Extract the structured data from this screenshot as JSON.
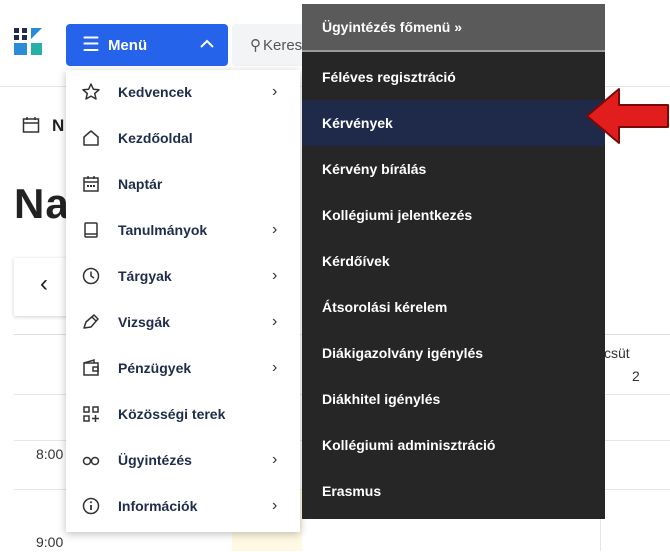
{
  "header": {
    "menu_label": "Menü",
    "search_text": "Keres"
  },
  "background": {
    "partial_label": "N",
    "big_title": "Na",
    "time_8": "8:00",
    "time_9": "9:00",
    "thursday_label": "csüt",
    "thursday_number": "2"
  },
  "main_menu": {
    "items": [
      {
        "label": "Kedvencek",
        "icon": "star-icon",
        "has_submenu": true
      },
      {
        "label": "Kezdőoldal",
        "icon": "home-icon",
        "has_submenu": false
      },
      {
        "label": "Naptár",
        "icon": "calendar-icon",
        "has_submenu": false
      },
      {
        "label": "Tanulmányok",
        "icon": "book-icon",
        "has_submenu": true
      },
      {
        "label": "Tárgyak",
        "icon": "clock-icon",
        "has_submenu": true
      },
      {
        "label": "Vizsgák",
        "icon": "edit-icon",
        "has_submenu": true
      },
      {
        "label": "Pénzügyek",
        "icon": "wallet-icon",
        "has_submenu": true
      },
      {
        "label": "Közösségi terek",
        "icon": "community-icon",
        "has_submenu": false
      },
      {
        "label": "Ügyintézés",
        "icon": "link-icon",
        "has_submenu": true
      },
      {
        "label": "Információk",
        "icon": "info-icon",
        "has_submenu": true
      }
    ]
  },
  "sub_menu": {
    "title": "Ügyintézés főmenü »",
    "items": [
      {
        "label": "Féléves regisztráció",
        "active": false
      },
      {
        "label": "Kérvények",
        "active": true
      },
      {
        "label": "Kérvény bírálás",
        "active": false
      },
      {
        "label": "Kollégiumi jelentkezés",
        "active": false
      },
      {
        "label": "Kérdőívek",
        "active": false
      },
      {
        "label": "Átsorolási kérelem",
        "active": false
      },
      {
        "label": "Diákigazolvány igénylés",
        "active": false
      },
      {
        "label": "Diákhitel igénylés",
        "active": false
      },
      {
        "label": "Kollégiumi adminisztráció",
        "active": false
      },
      {
        "label": "Erasmus",
        "active": false
      }
    ]
  },
  "colors": {
    "menu_button": "#2563eb",
    "submenu_bg": "#262626",
    "submenu_active": "#1f2a4a",
    "arrow": "#e11d1d"
  }
}
